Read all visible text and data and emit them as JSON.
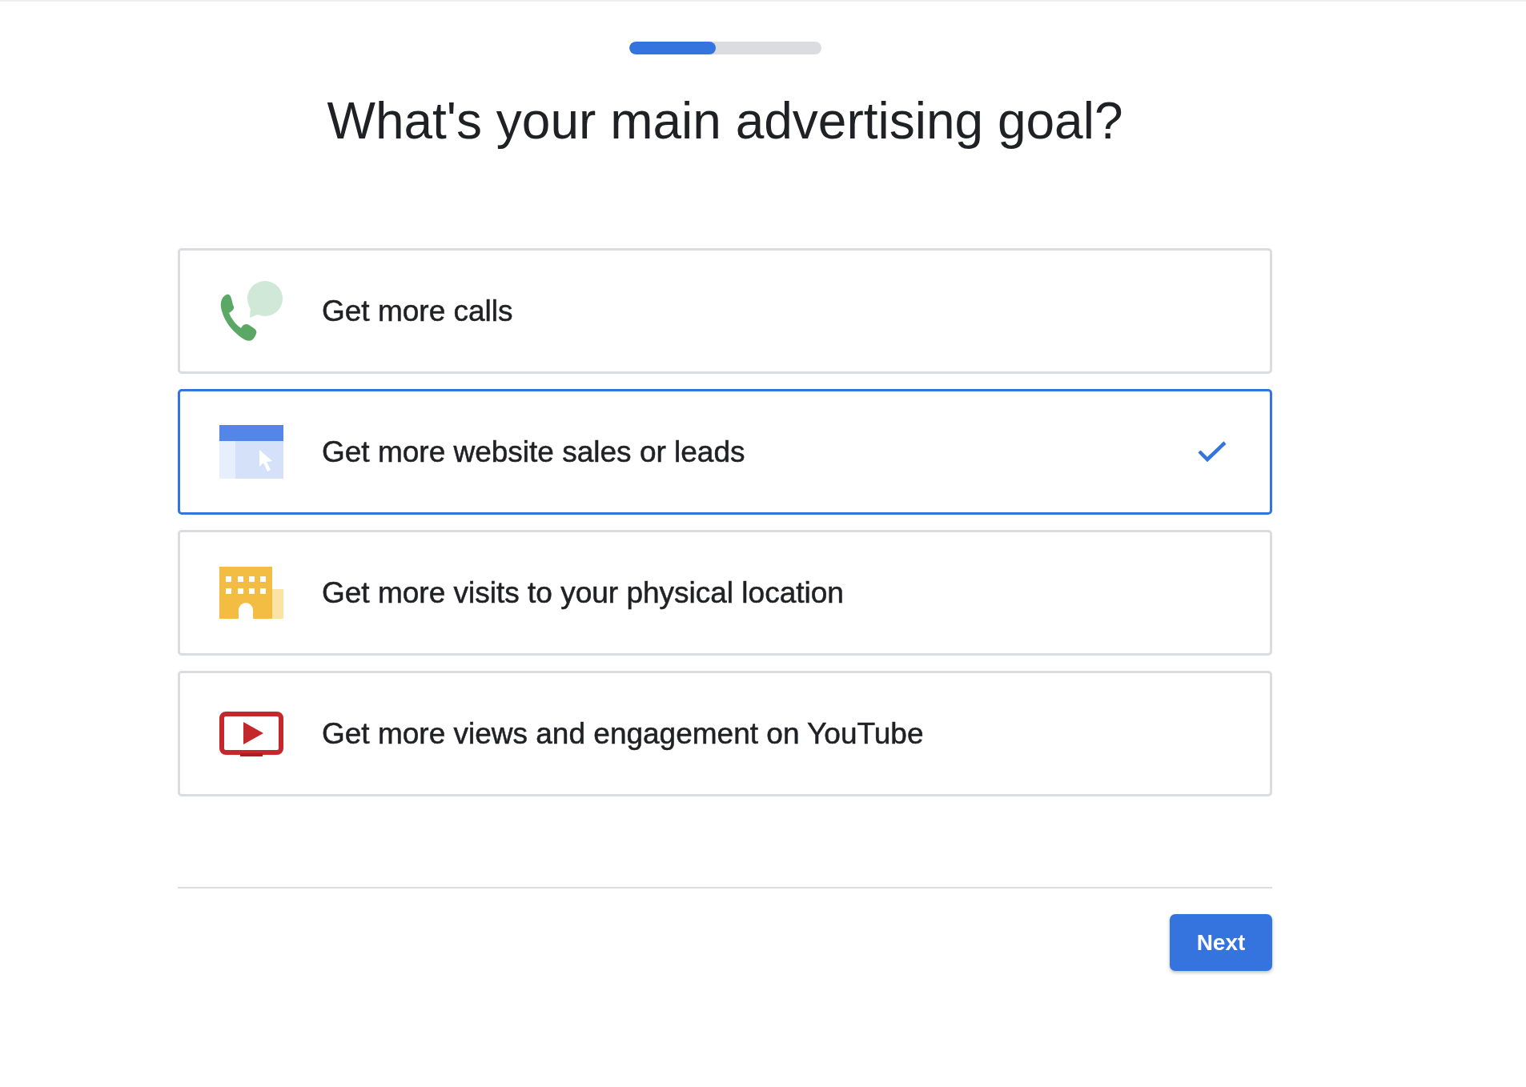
{
  "progress": {
    "level": 0.45
  },
  "title": "What's your main advertising goal?",
  "goals": [
    {
      "kind": "calls",
      "label": "Get more calls",
      "selected": false
    },
    {
      "kind": "website",
      "label": "Get more website sales or leads",
      "selected": true
    },
    {
      "kind": "visits",
      "label": "Get more visits to your physical location",
      "selected": false
    },
    {
      "kind": "youtube",
      "label": "Get more views and engagement on YouTube",
      "selected": false
    }
  ],
  "next_button": {
    "label": "Next"
  }
}
